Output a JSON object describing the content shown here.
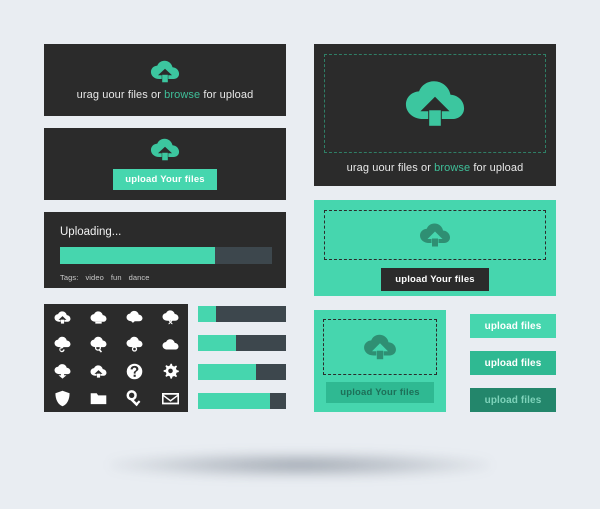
{
  "theme": {
    "background": "#e9edf2",
    "dark_panel": "#2b2b2b",
    "teal": "#46d6ae",
    "teal_mid": "#2fb992",
    "teal_dark": "#23866b",
    "track_gray": "#3d474d",
    "link_green": "#3fbf99"
  },
  "cards": {
    "drag_dark": {
      "name": "drag-and-drop-dark-card",
      "icon": "cloud-upload-icon",
      "caption_pre": "urag uour files or ",
      "caption_link": "browse",
      "caption_post": " for upload"
    },
    "upload_dark": {
      "name": "upload-button-dark-card",
      "icon": "cloud-upload-icon",
      "button_label": "upload Your files"
    },
    "uploading": {
      "name": "uploading-progress-card",
      "title": "Uploading...",
      "progress_percent": 73,
      "tags_label": "Tags:",
      "tags": [
        "video",
        "fun",
        "dance"
      ]
    },
    "drop_dark_large": {
      "name": "dropzone-dark-large-card",
      "icon": "cloud-upload-icon",
      "caption_pre": "urag uour files or ",
      "caption_link": "browse",
      "caption_post": " for upload"
    },
    "drop_teal_large": {
      "name": "dropzone-teal-large-card",
      "icon": "cloud-upload-icon",
      "button_label": "upload Your files"
    },
    "drop_teal_small": {
      "name": "dropzone-teal-small-card",
      "icon": "cloud-upload-icon",
      "button_label": "upload Your files"
    }
  },
  "icon_grid": {
    "name": "cloud-icon-set",
    "icons": [
      "cloud-upload-icon",
      "cloud-minus-icon",
      "cloud-check-icon",
      "cloud-close-icon",
      "cloud-refresh-icon",
      "cloud-search-icon",
      "cloud-lock-icon",
      "cloud-icon",
      "cloud-download-icon",
      "cloud-arrow-up-icon",
      "question-mark-icon",
      "gear-icon",
      "shield-icon",
      "folder-icon",
      "key-icon",
      "envelope-icon"
    ]
  },
  "progress_bars": {
    "name": "progress-bar-stack",
    "values": [
      20,
      43,
      66,
      82
    ]
  },
  "button_stack": {
    "name": "upload-files-button-stack",
    "buttons": [
      {
        "label": "upload files",
        "state": "default"
      },
      {
        "label": "upload files",
        "state": "hover"
      },
      {
        "label": "upload files",
        "state": "pressed"
      }
    ]
  }
}
